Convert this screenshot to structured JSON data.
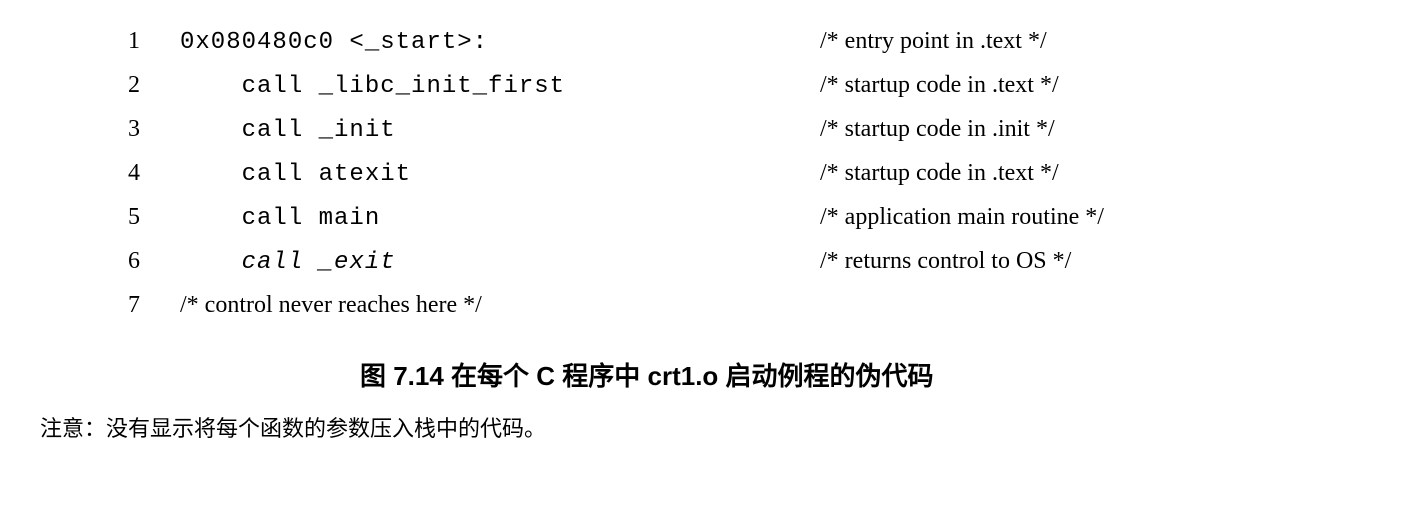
{
  "lines": [
    {
      "n": "1",
      "code": "0x080480c0 <_start>:",
      "comment": "/* entry point in .text */",
      "italic": false,
      "indent": 0
    },
    {
      "n": "2",
      "code": "call _libc_init_first",
      "comment": "/* startup code in .text */",
      "italic": false,
      "indent": 1
    },
    {
      "n": "3",
      "code": "call _init",
      "comment": "/* startup code in .init */",
      "italic": false,
      "indent": 1
    },
    {
      "n": "4",
      "code": "call atexit",
      "comment": "/* startup code in .text */",
      "italic": false,
      "indent": 1
    },
    {
      "n": "5",
      "code": "call main",
      "comment": "/* application main routine */",
      "italic": false,
      "indent": 1
    },
    {
      "n": "6",
      "code": "call _exit",
      "comment": "/* returns control to OS */",
      "italic": true,
      "indent": 1
    },
    {
      "n": "7",
      "code": "/* control never reaches here */",
      "comment": "",
      "italic": false,
      "indent": 0,
      "code_is_serif": true
    }
  ],
  "caption": "图 7.14  在每个 C 程序中 crt1.o 启动例程的伪代码",
  "note": "注意：没有显示将每个函数的参数压入栈中的代码。"
}
